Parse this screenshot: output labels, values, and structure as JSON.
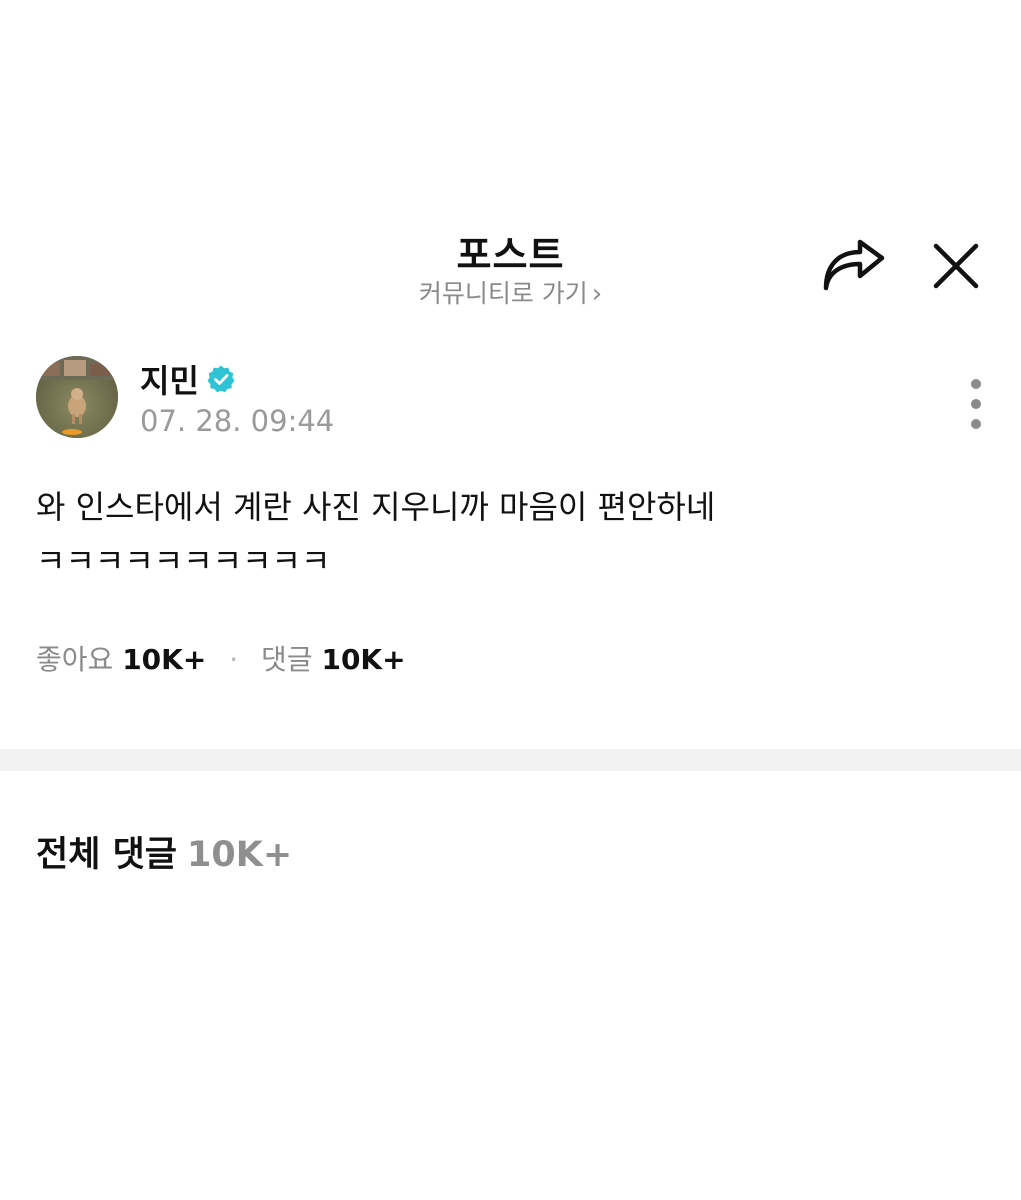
{
  "header": {
    "title": "포스트",
    "community_link_label": "커뮤니티로 가기",
    "community_link_chevron": "›",
    "share_icon": "share-arrow-icon",
    "close_icon": "close-icon"
  },
  "post": {
    "author": {
      "name": "지민",
      "verified": true,
      "verified_color": "#2ec4d6",
      "avatar_icon": "avatar-image"
    },
    "timestamp": "07. 28. 09:44",
    "more_icon": "more-vertical-icon",
    "body": "와 인스타에서 계란 사진 지우니까 마음이 편안하네 ㅋㅋㅋㅋㅋㅋㅋㅋㅋㅋ",
    "stats": {
      "likes_label": "좋아요",
      "likes_count": "10K+",
      "separator": "·",
      "comments_label": "댓글",
      "comments_count": "10K+"
    }
  },
  "comments_section": {
    "title": "전체 댓글",
    "count": "10K+"
  }
}
